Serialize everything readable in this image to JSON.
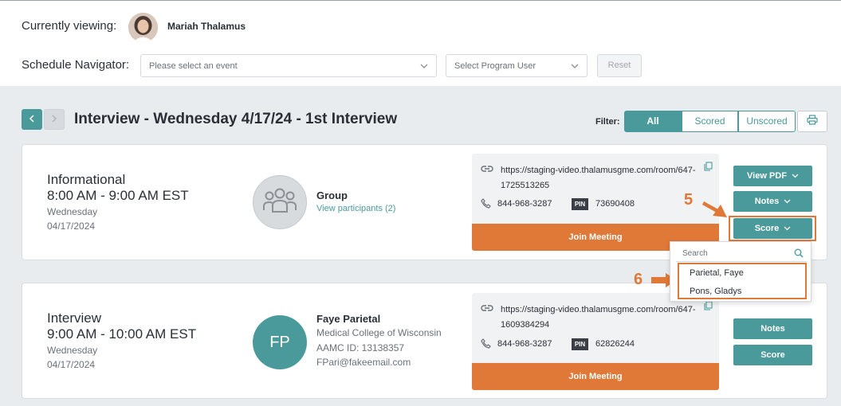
{
  "header": {
    "currently_viewing_label": "Currently viewing:",
    "user_name": "Mariah Thalamus",
    "schedule_navigator_label": "Schedule Navigator:",
    "event_select_placeholder": "Please select an event",
    "program_user_placeholder": "Select Program User",
    "reset_label": "Reset"
  },
  "toolbar": {
    "title": "Interview - Wednesday 4/17/24 - 1st Interview",
    "filter_label": "Filter:",
    "filters": [
      "All",
      "Scored",
      "Unscored"
    ],
    "active_filter": "All"
  },
  "cards": [
    {
      "type": "Informational",
      "time": "8:00 AM - 9:00 AM EST",
      "day": "Wednesday",
      "date": "04/17/2024",
      "participant_name": "Group",
      "participant_link": "View participants (2)",
      "meeting_url": "https://staging-video.thalamusgme.com/room/647-1725513265",
      "phone": "844-968-3287",
      "pin_label": "PIN",
      "pin": "73690408",
      "join_label": "Join Meeting",
      "actions": [
        "View PDF",
        "Notes",
        "Score"
      ]
    },
    {
      "type": "Interview",
      "time": "9:00 AM - 10:00 AM EST",
      "day": "Wednesday",
      "date": "04/17/2024",
      "initials": "FP",
      "participant_name": "Faye Parietal",
      "school": "Medical College of Wisconsin",
      "aamc_id": "AAMC ID: 13138357",
      "email": "FPari@fakeemail.com",
      "meeting_url": "https://staging-video.thalamusgme.com/room/647-1609384294",
      "phone": "844-968-3287",
      "pin_label": "PIN",
      "pin": "62826244",
      "join_label": "Join Meeting",
      "actions": [
        "Notes",
        "Score"
      ]
    }
  ],
  "score_dropdown": {
    "search_placeholder": "Search",
    "options": [
      "Parietal, Faye",
      "Pons, Gladys"
    ]
  },
  "callouts": [
    "5",
    "6"
  ],
  "colors": {
    "teal": "#4a9a9b",
    "orange": "#e07838"
  }
}
